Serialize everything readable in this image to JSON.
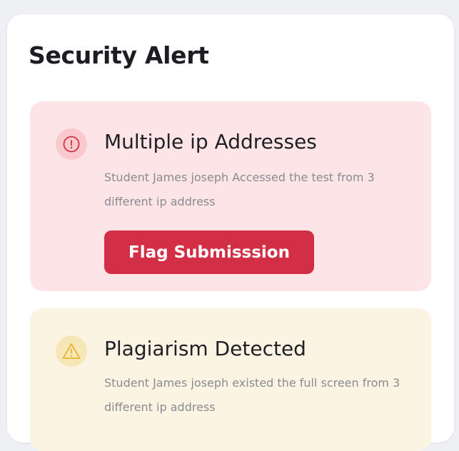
{
  "panel": {
    "title": "Security Alert"
  },
  "alerts": [
    {
      "icon": "info-icon",
      "title": "Multiple ip Addresses",
      "description": "Student James joseph Accessed the test from 3 different ip address",
      "action_label": "Flag Submisssion",
      "accent": "#d22f46",
      "background": "#fde4e6"
    },
    {
      "icon": "warning-icon",
      "title": "Plagiarism Detected",
      "description": "Student James joseph existed the full screen from 3 different ip address",
      "accent": "#e7b630",
      "background": "#fbf4e2"
    }
  ]
}
